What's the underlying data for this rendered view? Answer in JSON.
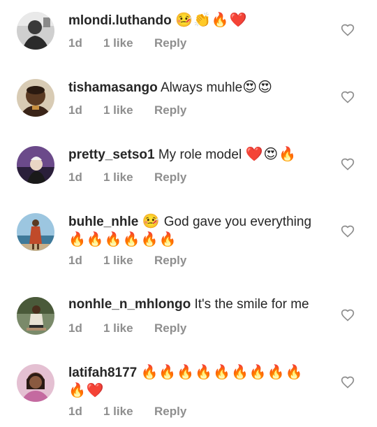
{
  "comments": [
    {
      "username": "mlondi.luthando",
      "text": "",
      "emoji": "🤒👏🔥❤️",
      "emoji_line2": "",
      "time": "1d",
      "likes": "1 like",
      "reply": "Reply"
    },
    {
      "username": "tishamasango",
      "text": "Always muhle",
      "emoji": "😍😍",
      "emoji_line2": "",
      "time": "1d",
      "likes": "1 like",
      "reply": "Reply"
    },
    {
      "username": "pretty_setso1",
      "text": "My role model",
      "emoji": "❤️😍🔥",
      "emoji_line2": "",
      "time": "1d",
      "likes": "1 like",
      "reply": "Reply"
    },
    {
      "username": "buhle_nhle",
      "text": "God gave you everything",
      "emoji": "🤒",
      "emoji_line2": "🔥🔥🔥🔥🔥🔥",
      "time": "1d",
      "likes": "1 like",
      "reply": "Reply"
    },
    {
      "username": "nonhle_n_mhlongo",
      "text": "It's  the smile for me",
      "emoji": "",
      "emoji_line2": "",
      "time": "1d",
      "likes": "1 like",
      "reply": "Reply"
    },
    {
      "username": "latifah8177",
      "text": "",
      "emoji": "🔥🔥🔥🔥🔥🔥🔥🔥🔥",
      "emoji_line2": "🔥❤️",
      "time": "1d",
      "likes": "1 like",
      "reply": "Reply"
    }
  ],
  "icons": {
    "like": "heart-outline-icon"
  },
  "colors": {
    "text": "#262626",
    "meta": "#8e8e8e",
    "heart_outline": "#8e8e8e"
  }
}
